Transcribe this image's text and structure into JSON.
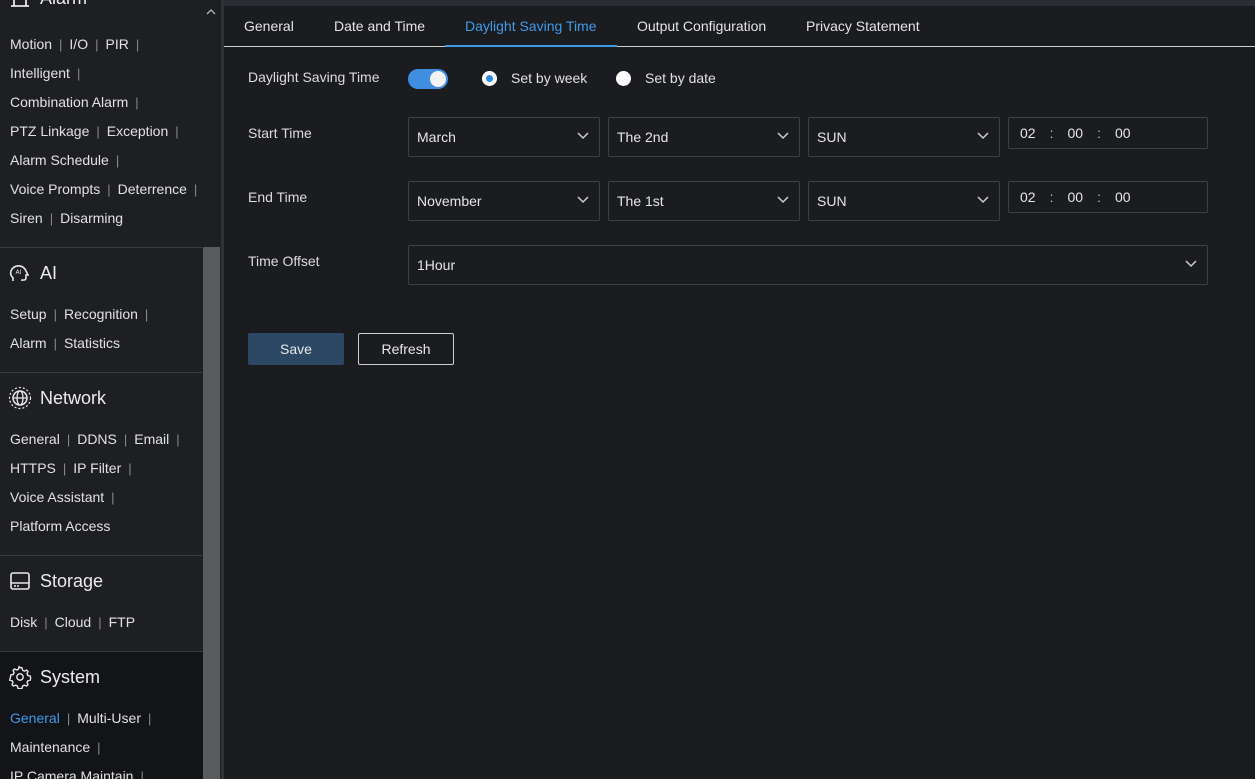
{
  "sidebar": {
    "alarm": {
      "title": "Alarm",
      "rows": [
        [
          "Motion",
          "I/O",
          "PIR"
        ],
        [
          "Intelligent"
        ],
        [
          "Combination Alarm"
        ],
        [
          "PTZ Linkage",
          "Exception"
        ],
        [
          "Alarm Schedule"
        ],
        [
          "Voice Prompts",
          "Deterrence"
        ],
        [
          "Siren",
          "Disarming"
        ]
      ]
    },
    "ai": {
      "title": "AI",
      "rows": [
        [
          "Setup",
          "Recognition"
        ],
        [
          "Alarm",
          "Statistics"
        ]
      ]
    },
    "network": {
      "title": "Network",
      "rows": [
        [
          "General",
          "DDNS",
          "Email"
        ],
        [
          "HTTPS",
          "IP Filter"
        ],
        [
          "Voice Assistant"
        ],
        [
          "Platform Access"
        ]
      ]
    },
    "storage": {
      "title": "Storage",
      "rows": [
        [
          "Disk",
          "Cloud",
          "FTP"
        ]
      ]
    },
    "system": {
      "title": "System",
      "rows": [
        [
          "General",
          "Multi-User"
        ],
        [
          "Maintenance"
        ],
        [
          "IP Camera Maintain"
        ]
      ],
      "active": "General"
    }
  },
  "tabs": [
    "General",
    "Date and Time",
    "Daylight Saving Time",
    "Output Configuration",
    "Privacy Statement"
  ],
  "active_tab": "Daylight Saving Time",
  "form": {
    "dst_label": "Daylight Saving Time",
    "dst_enabled": true,
    "mode_week": "Set by week",
    "mode_date": "Set by date",
    "mode_selected": "Set by week",
    "start_label": "Start Time",
    "start": {
      "month": "March",
      "week": "The 2nd",
      "day": "SUN",
      "hh": "02",
      "mm": "00",
      "ss": "00"
    },
    "end_label": "End Time",
    "end": {
      "month": "November",
      "week": "The 1st",
      "day": "SUN",
      "hh": "02",
      "mm": "00",
      "ss": "00"
    },
    "offset_label": "Time Offset",
    "offset": "1Hour",
    "time_sep": ":"
  },
  "buttons": {
    "save": "Save",
    "refresh": "Refresh"
  },
  "colors": {
    "accent": "#3f9ae8",
    "save_bg": "#2d4864",
    "toggle_on": "#3f8ee0"
  }
}
